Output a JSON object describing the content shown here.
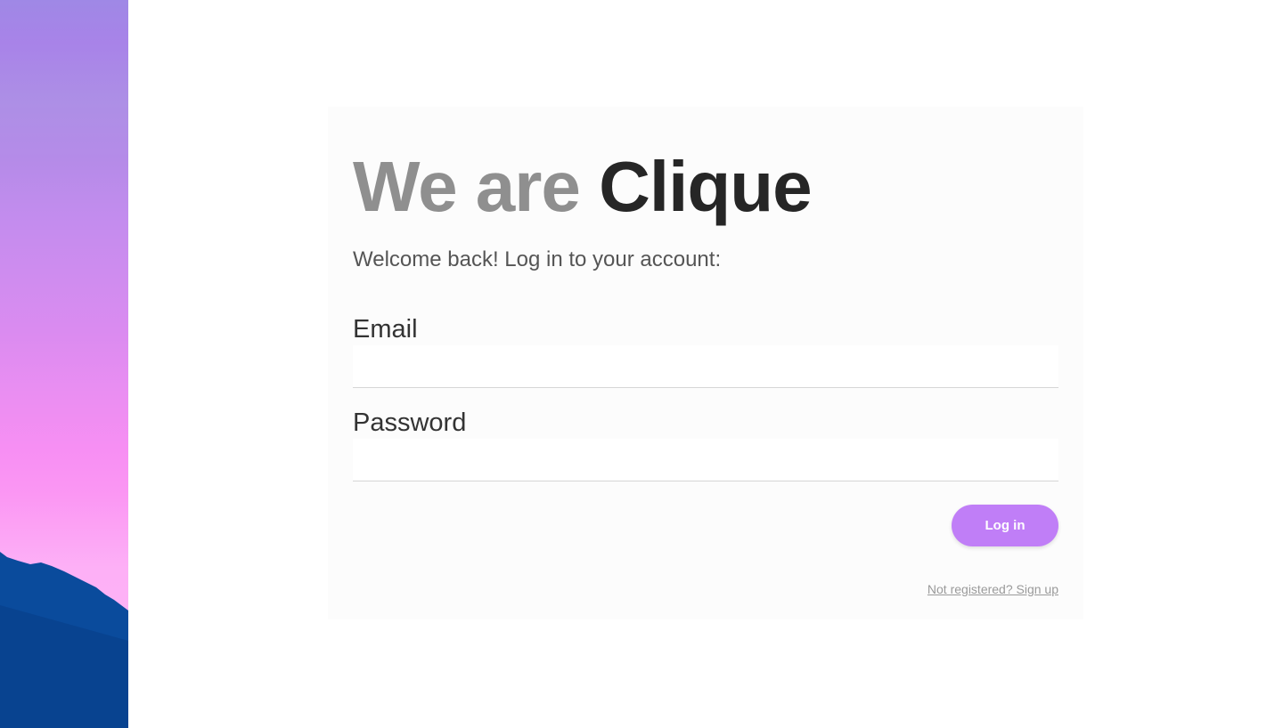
{
  "brand": {
    "headline_muted": "We are ",
    "headline_strong": "Clique"
  },
  "login": {
    "subtitle": "Welcome back! Log in to your account:",
    "email_label": "Email",
    "email_value": "",
    "password_label": "Password",
    "password_value": "",
    "submit_label": "Log in",
    "signup_link": "Not registered? Sign up"
  },
  "colors": {
    "accent": "#c07ef7",
    "headline_muted": "#8f8f8f",
    "headline_strong": "#262626",
    "mountain": "#0a4b9c"
  }
}
